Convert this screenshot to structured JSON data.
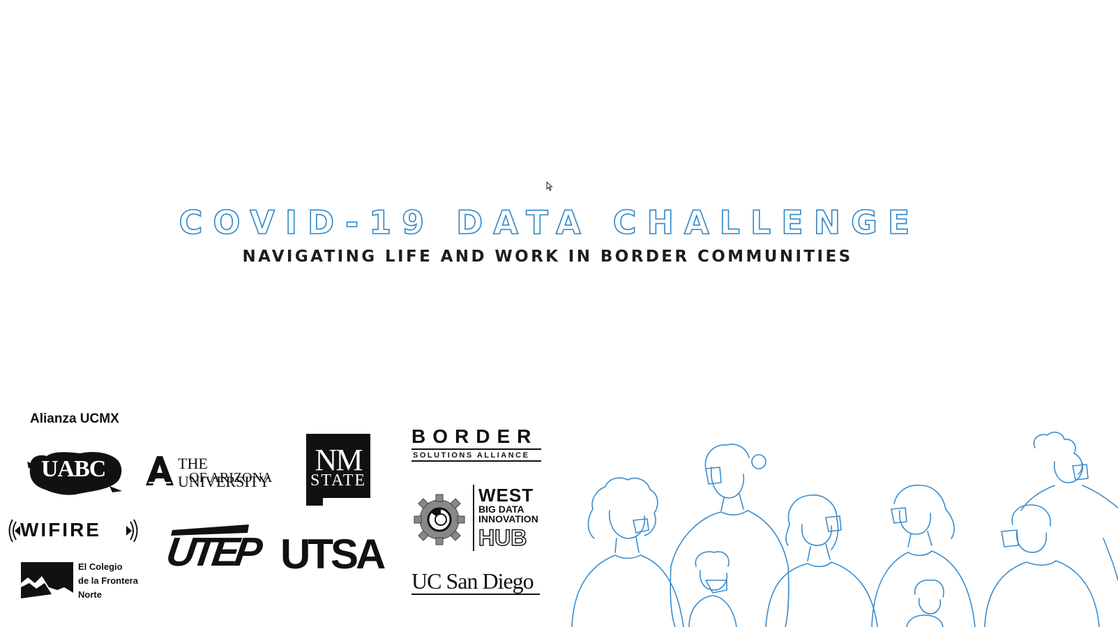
{
  "slide": {
    "title": "COVID-19 DATA CHALLENGE",
    "subtitle": "NAVIGATING LIFE AND WORK IN BORDER COMMUNITIES",
    "alianza_label": "Alianza UCMX"
  },
  "logos": {
    "uabc": "UABC",
    "arizona_line1": "THE UNIVERSITY",
    "arizona_line2": "OF ARIZONA",
    "nmstate_line1": "NM",
    "nmstate_line2": "STATE",
    "border_line1": "BORDER",
    "border_line2": "SOLUTIONS ALLIANCE",
    "wifire": "WIFIRE",
    "utep": "UTEP",
    "utsa": "UTSA",
    "west_line1": "WEST",
    "west_line2": "BIG DATA",
    "west_line3": "INNOVATION",
    "west_line4": "HUB",
    "ucsd": "UC San Diego",
    "colef_line1": "El Colegio",
    "colef_line2": "de la Frontera",
    "colef_line3": "Norte"
  },
  "colors": {
    "title_outline": "#2c86c7",
    "subtitle": "#1d1d1d",
    "illustration_stroke": "#3a8ccc"
  }
}
